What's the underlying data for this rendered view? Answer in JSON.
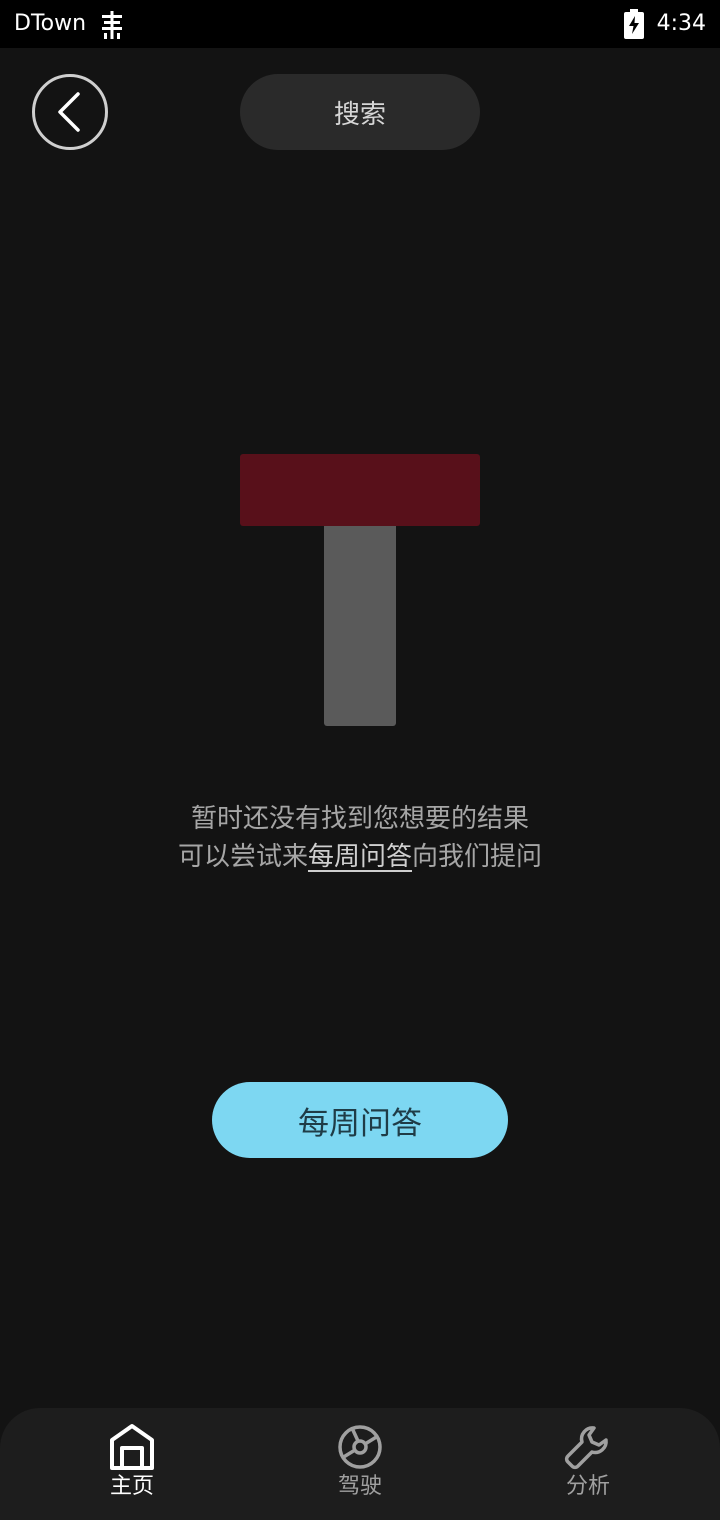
{
  "status_bar": {
    "carrier": "DTown",
    "time": "4:34",
    "network_icon": "signal-icon",
    "battery_icon": "battery-charging-icon"
  },
  "header": {
    "back_icon": "chevron-left-icon",
    "search_label": "搜索"
  },
  "empty_state": {
    "line1": "暂时还没有找到您想要的结果",
    "line2_prefix": "可以尝试来",
    "line2_link": "每周问答",
    "line2_suffix": "向我们提问",
    "illustration_colors": {
      "top": "#58101a",
      "stem": "#5a5a5a"
    }
  },
  "cta": {
    "label": "每周问答",
    "color": "#7dd7f2"
  },
  "bottom_nav": {
    "items": [
      {
        "label": "主页",
        "icon": "home-icon",
        "active": true
      },
      {
        "label": "驾驶",
        "icon": "steering-wheel-icon",
        "active": false
      },
      {
        "label": "分析",
        "icon": "wrench-icon",
        "active": false
      }
    ]
  }
}
